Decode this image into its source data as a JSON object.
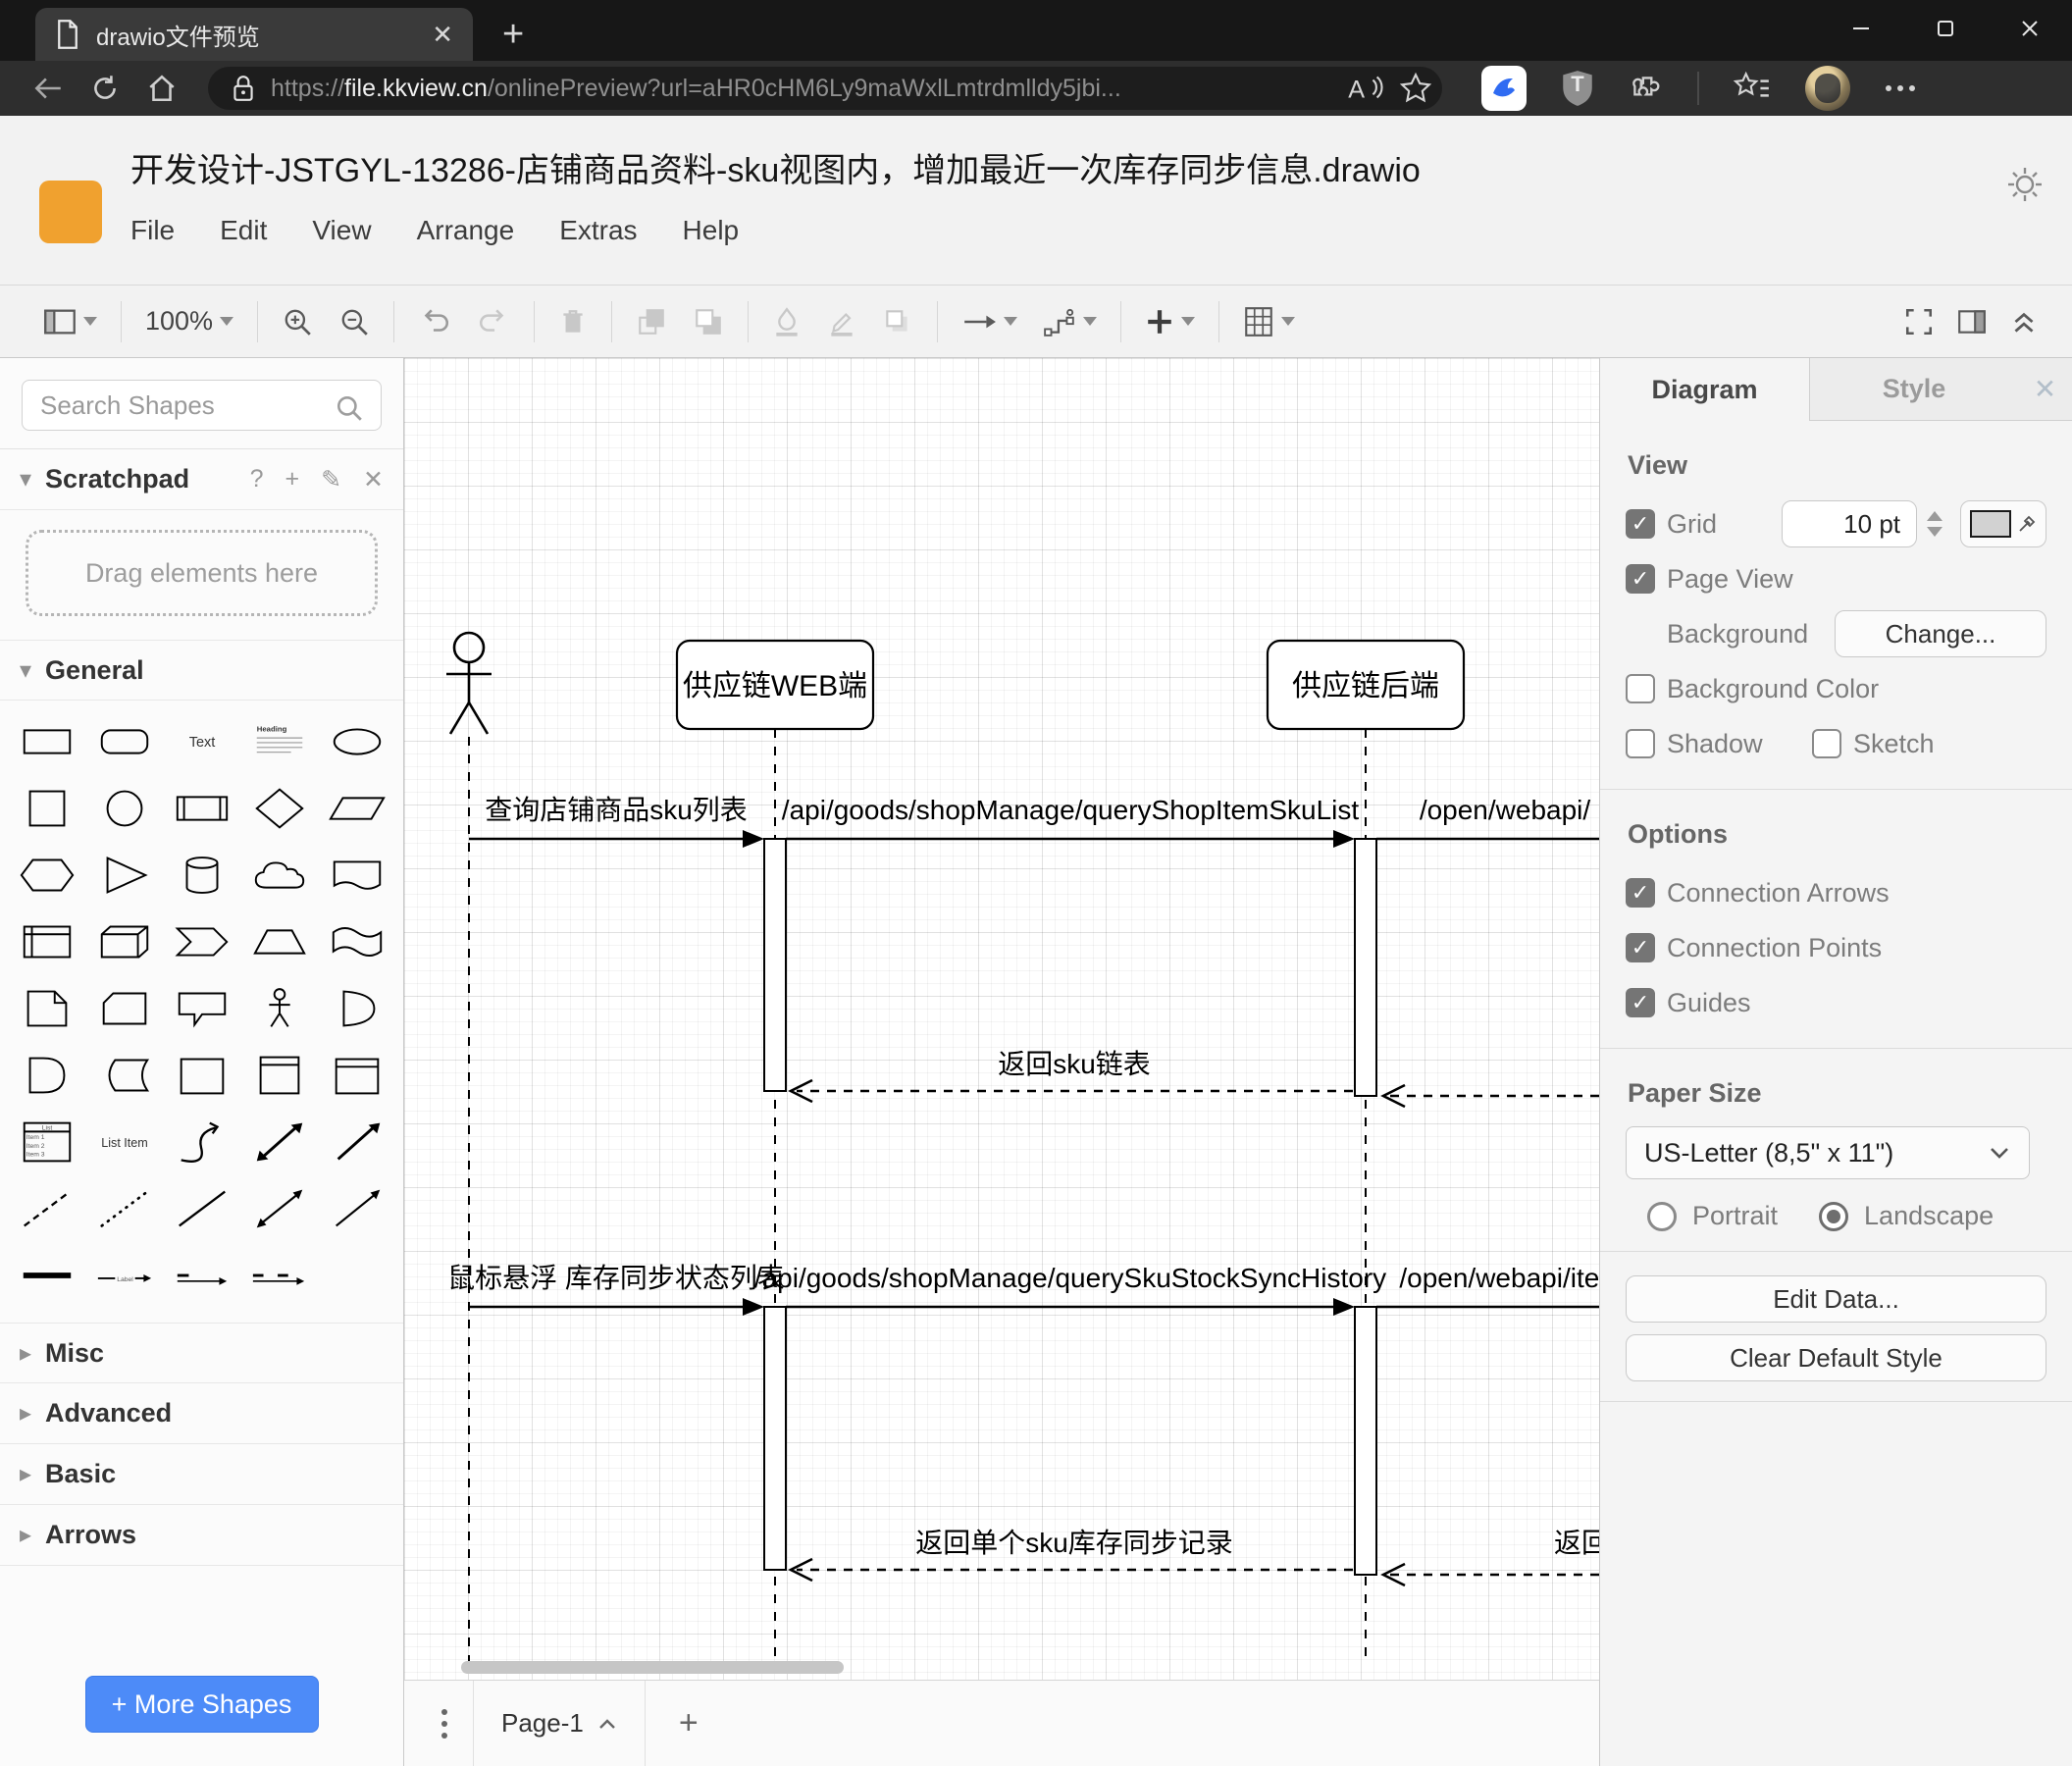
{
  "browser": {
    "tab_title": "drawio文件预览",
    "url_scheme": "https://",
    "url_host": "file.kkview.cn",
    "url_path": "/onlinePreview?url=aHR0cHM6Ly9maWxlLmtrdmlldy5jbi...",
    "icons": [
      "document-icon",
      "close-icon",
      "new-tab-icon",
      "minimize-icon",
      "maximize-icon",
      "window-close-icon",
      "back-icon",
      "refresh-icon",
      "home-icon",
      "lock-icon",
      "read-aloud-icon",
      "favorite-star-icon",
      "blue-app-extension-icon",
      "shield-extension-icon",
      "extensions-puzzle-icon",
      "collections-icon",
      "avatar",
      "more-icon"
    ]
  },
  "header": {
    "logo_color": "#F0A12F",
    "title": "开发设计-JSTGYL-13286-店铺商品资料-sku视图内，增加最近一次库存同步信息.drawio",
    "menus": [
      "File",
      "Edit",
      "View",
      "Arrange",
      "Extras",
      "Help"
    ]
  },
  "toolbar": {
    "zoom_level": "100%",
    "icons": [
      "page-view-icon",
      "zoom-in-icon",
      "zoom-out-icon",
      "undo-icon",
      "redo-icon",
      "delete-icon",
      "to-front-icon",
      "to-back-icon",
      "fill-color-icon",
      "line-color-icon",
      "shadow-icon",
      "connection-icon",
      "waypoints-icon",
      "insert-icon",
      "table-icon",
      "fullscreen-icon",
      "format-panel-icon",
      "collapse-expand-icon"
    ]
  },
  "sidebar": {
    "search_placeholder": "Search Shapes",
    "scratchpad_label": "Scratchpad",
    "scratchpad_hint": "Drag elements here",
    "sections": {
      "general": "General",
      "misc": "Misc",
      "advanced": "Advanced",
      "basic": "Basic",
      "arrows": "Arrows"
    },
    "shape_texts": {
      "text": "Text",
      "heading": "Heading",
      "list": "List",
      "item1": "Item 1",
      "item2": "Item 2",
      "item3": "Item 3",
      "list_item": "List Item",
      "label": "Label"
    },
    "more_shapes_label": "+ More Shapes",
    "shapes": [
      "rectangle",
      "rounded-rectangle",
      "text",
      "heading",
      "ellipse",
      "square",
      "circle",
      "process",
      "diamond",
      "parallelogram",
      "hexagon",
      "triangle",
      "cylinder",
      "cloud",
      "document",
      "internal-storage",
      "cube",
      "step",
      "trapezoid",
      "tape",
      "note",
      "card",
      "callout",
      "actor",
      "or",
      "and",
      "data-storage",
      "container",
      "vertical-container",
      "horizontal-container",
      "list",
      "list-item",
      "curve",
      "bidirectional-arrow",
      "directional-arrow",
      "dashed-line",
      "dotted-line",
      "line",
      "bidirectional-connector",
      "directional-connector",
      "horizontal-line",
      "labeled-arrow",
      "arrow-with-label",
      "arrow-source-target"
    ]
  },
  "canvas": {
    "lifelines": {
      "web": "供应链WEB端",
      "backend": "供应链后端"
    },
    "messages": {
      "m1": "查询店铺商品sku列表",
      "m2": "/api/goods/shopManage/queryShopItemSkuList",
      "m3": "/open/webapi/",
      "r1": "返回sku链表",
      "m4": "鼠标悬浮 库存同步状态列表",
      "m5": "/api/goods/shopManage/querySkuStockSyncHistory",
      "m6": "/open/webapi/item",
      "r2": "返回单个sku库存同步记录",
      "r3": "返回"
    }
  },
  "footer": {
    "page_tab": "Page-1",
    "add_page": "+"
  },
  "panel": {
    "tab_diagram": "Diagram",
    "tab_style": "Style",
    "view_heading": "View",
    "grid_label": "Grid",
    "grid_size": "10 pt",
    "page_view_label": "Page View",
    "background_label": "Background",
    "change_button": "Change...",
    "background_color_label": "Background Color",
    "shadow_label": "Shadow",
    "sketch_label": "Sketch",
    "options_heading": "Options",
    "option_connection_arrows": "Connection Arrows",
    "option_connection_points": "Connection Points",
    "option_guides": "Guides",
    "paper_heading": "Paper Size",
    "paper_size_value": "US-Letter (8,5\" x 11\")",
    "portrait_label": "Portrait",
    "landscape_label": "Landscape",
    "edit_data_button": "Edit Data...",
    "clear_style_button": "Clear Default Style"
  }
}
